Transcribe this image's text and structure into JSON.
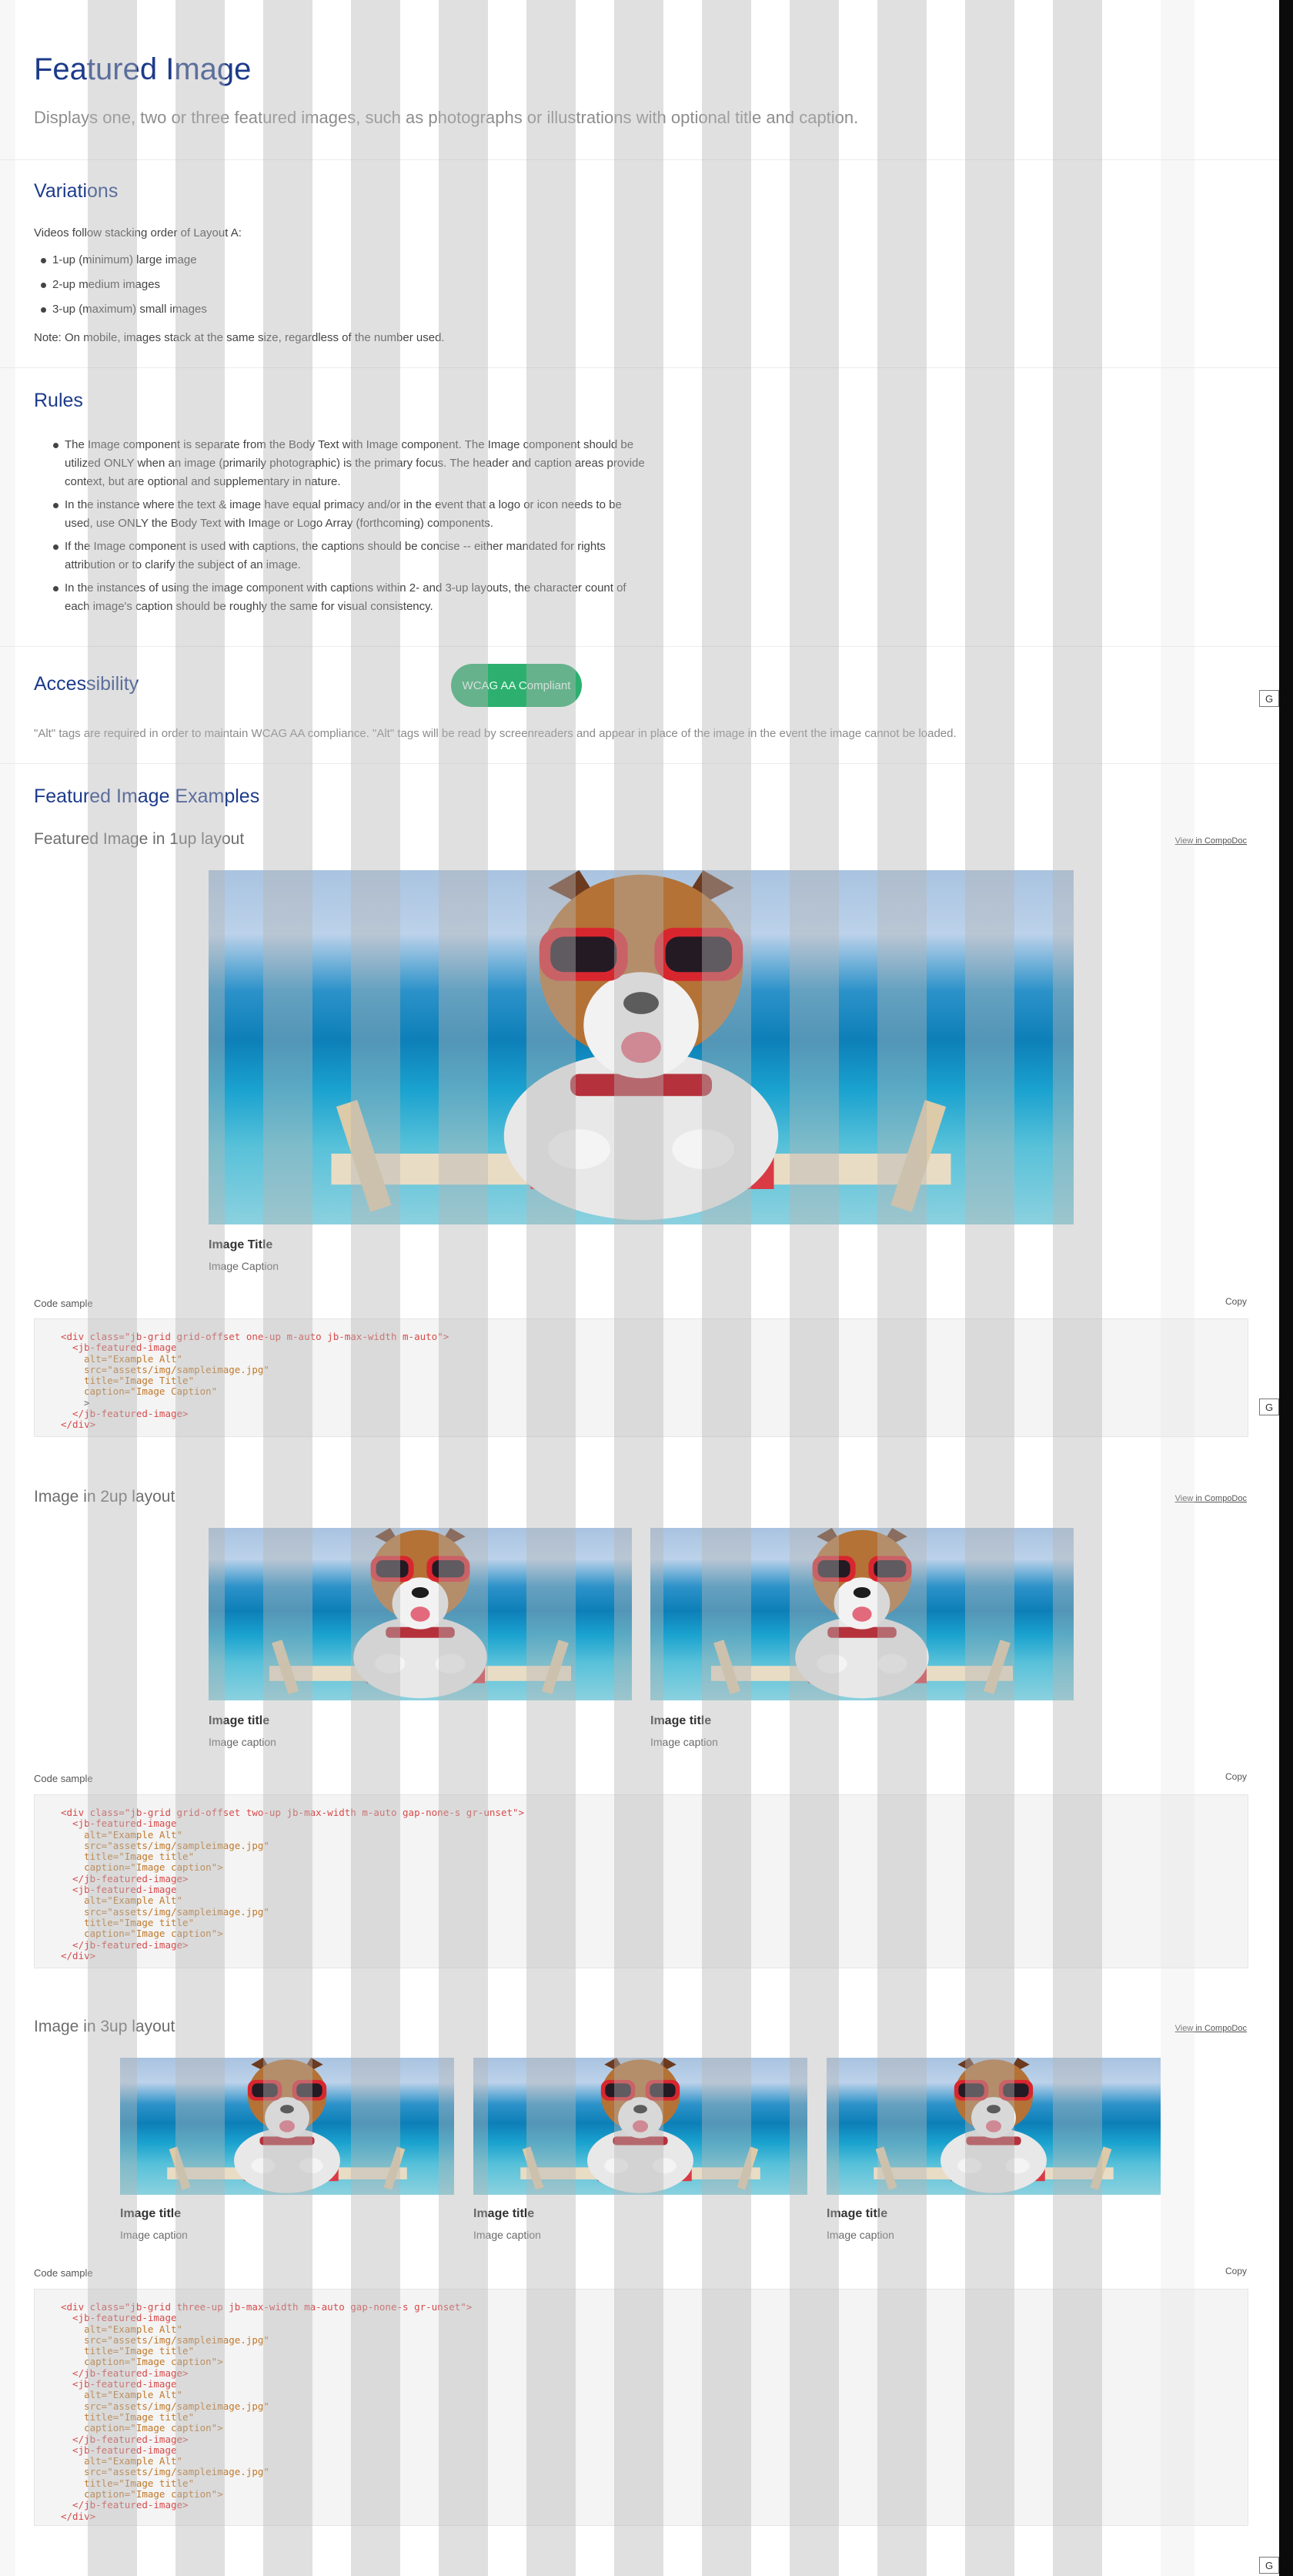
{
  "header": {
    "title": "Featured Image",
    "subtitle": "Displays one, two or three featured images, such as photographs or illustrations with optional title and caption."
  },
  "variations": {
    "heading": "Variations",
    "intro": "Videos follow stacking order of Layout A:",
    "items": [
      "1-up (minimum) large image",
      "2-up medium images",
      "3-up (maximum) small images"
    ],
    "note": "Note: On mobile, images stack at the same size, regardless of the number used."
  },
  "rules": {
    "heading": "Rules",
    "items": [
      "The Image component is separate from the Body Text with Image component. The Image component should be utilized ONLY when an image (primarily photographic) is the primary focus. The header and caption areas provide context, but are optional and supplementary in nature.",
      "In the instance where the text & image have equal primacy and/or in the event that a logo or icon needs to be used, use ONLY the Body Text with Image or Logo Array (forthcoming) components.",
      "If the Image component is used with captions, the captions should be concise -- either mandated for rights attribution or to clarify the subject of an image.",
      "In the instances of using the image component with captions within 2- and 3-up layouts, the character count of each image's caption should be roughly the same for visual consistency."
    ]
  },
  "accessibility": {
    "heading": "Accessibility",
    "badge": "WCAG AA Compliant",
    "text": "\"Alt\" tags are required in order to maintain WCAG AA compliance. \"Alt\" tags will be read by screenreaders and appear in place of the image in the event the image cannot be loaded."
  },
  "markers": {
    "g": "G"
  },
  "examples": {
    "heading": "Featured Image Examples",
    "view_link": "View in CompoDoc",
    "code_label": "Code sample",
    "copy_label": "Copy",
    "oneup": {
      "heading": "Featured Image in 1up layout",
      "title": "Image Title",
      "caption": "Image Caption"
    },
    "twoup": {
      "heading": "Image in 2up layout",
      "items": [
        {
          "title": "Image title",
          "caption": "Image caption"
        },
        {
          "title": "Image title",
          "caption": "Image caption"
        }
      ]
    },
    "threeup": {
      "heading": "Image in 3up layout",
      "items": [
        {
          "title": "Image title",
          "caption": "Image caption"
        },
        {
          "title": "Image title",
          "caption": "Image caption"
        },
        {
          "title": "Image title",
          "caption": "Image caption"
        }
      ]
    }
  },
  "code": {
    "oneup": {
      "div_open": "<div class=\"jb-grid grid-offset one-up m-auto jb-max-width m-auto\">",
      "lines": [
        "  <jb-featured-image",
        "    alt=\"Example Alt\"",
        "    src=\"assets/img/sampleimage.jpg\"",
        "    title=\"Image Title\"",
        "    caption=\"Image Caption\"",
        "    >",
        "  </jb-featured-image>"
      ],
      "div_close": "</div>"
    },
    "twoup": {
      "div_open": "<div class=\"jb-grid grid-offset two-up jb-max-width m-auto gap-none-s gr-unset\">",
      "lines": [
        "  <jb-featured-image",
        "    alt=\"Example Alt\"",
        "    src=\"assets/img/sampleimage.jpg\"",
        "    title=\"Image title\"",
        "    caption=\"Image caption\">",
        "  </jb-featured-image>",
        "  <jb-featured-image",
        "    alt=\"Example Alt\"",
        "    src=\"assets/img/sampleimage.jpg\"",
        "    title=\"Image title\"",
        "    caption=\"Image caption\">",
        "  </jb-featured-image>"
      ],
      "div_close": "</div>"
    },
    "threeup": {
      "div_open": "<div class=\"jb-grid three-up jb-max-width ma-auto gap-none-s gr-unset\">",
      "lines": [
        "  <jb-featured-image",
        "    alt=\"Example Alt\"",
        "    src=\"assets/img/sampleimage.jpg\"",
        "    title=\"Image title\"",
        "    caption=\"Image caption\">",
        "  </jb-featured-image>",
        "  <jb-featured-image",
        "    alt=\"Example Alt\"",
        "    src=\"assets/img/sampleimage.jpg\"",
        "    title=\"Image title\"",
        "    caption=\"Image caption\">",
        "  </jb-featured-image>",
        "  <jb-featured-image",
        "    alt=\"Example Alt\"",
        "    src=\"assets/img/sampleimage.jpg\"",
        "    title=\"Image title\"",
        "    caption=\"Image caption\">",
        "  </jb-featured-image>"
      ],
      "div_close": "</div>"
    }
  }
}
